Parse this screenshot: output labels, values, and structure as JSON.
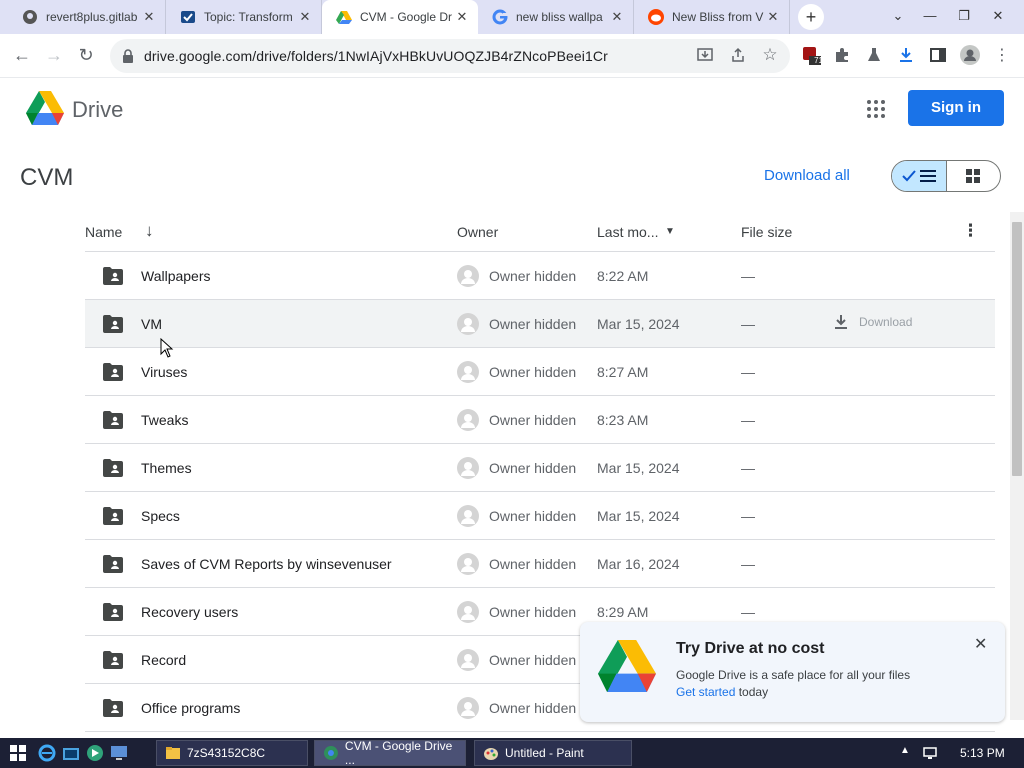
{
  "browser": {
    "tabs": [
      {
        "title": "revert8plus.gitlab",
        "icon": "github-icon"
      },
      {
        "title": "Topic: Transform",
        "icon": "forum-icon"
      },
      {
        "title": "CVM - Google Dr",
        "icon": "drive-icon",
        "active": true
      },
      {
        "title": "new bliss wallpa",
        "icon": "google-icon"
      },
      {
        "title": "New Bliss from V",
        "icon": "reddit-icon"
      }
    ],
    "new_tab": "+",
    "url": "drive.google.com/drive/folders/1NwIAjVxHBkUvUOQZJB4rZNcoPBeei1Cr",
    "ext_badge": "71"
  },
  "header": {
    "app_name": "Drive",
    "signin_label": "Sign in"
  },
  "folder": {
    "title": "CVM",
    "download_all_label": "Download all"
  },
  "columns": {
    "name": "Name",
    "owner": "Owner",
    "modified": "Last mo...",
    "size": "File size"
  },
  "rows": [
    {
      "name": "Wallpapers",
      "owner": "Owner hidden",
      "modified": "8:22 AM",
      "size": "—"
    },
    {
      "name": "VM",
      "owner": "Owner hidden",
      "modified": "Mar 15, 2024",
      "size": "—",
      "download": "Download"
    },
    {
      "name": "Viruses",
      "owner": "Owner hidden",
      "modified": "8:27 AM",
      "size": "—"
    },
    {
      "name": "Tweaks",
      "owner": "Owner hidden",
      "modified": "8:23 AM",
      "size": "—"
    },
    {
      "name": "Themes",
      "owner": "Owner hidden",
      "modified": "Mar 15, 2024",
      "size": "—"
    },
    {
      "name": "Specs",
      "owner": "Owner hidden",
      "modified": "Mar 15, 2024",
      "size": "—"
    },
    {
      "name": "Saves of CVM Reports by winsevenuser",
      "owner": "Owner hidden",
      "modified": "Mar 16, 2024",
      "size": "—"
    },
    {
      "name": "Recovery users",
      "owner": "Owner hidden",
      "modified": "8:29 AM",
      "size": "—"
    },
    {
      "name": "Record",
      "owner": "Owner hidden",
      "modified": "",
      "size": ""
    },
    {
      "name": "Office programs",
      "owner": "Owner hidden",
      "modified": "",
      "size": ""
    }
  ],
  "promo": {
    "title": "Try Drive at no cost",
    "description": "Google Drive is a safe place for all your files",
    "link_text": "Get started",
    "link_suffix": " today",
    "close": "✕"
  },
  "taskbar": {
    "items": [
      {
        "label": "7zS43152C8C"
      },
      {
        "label": "CVM - Google Drive ..."
      },
      {
        "label": "Untitled - Paint"
      }
    ],
    "clock": "5:13 PM"
  },
  "colors": {
    "accent": "#1a73e8",
    "tabbar": "#dfe1f5",
    "taskbar": "#1c2035",
    "selected_view": "#c2e7ff"
  }
}
